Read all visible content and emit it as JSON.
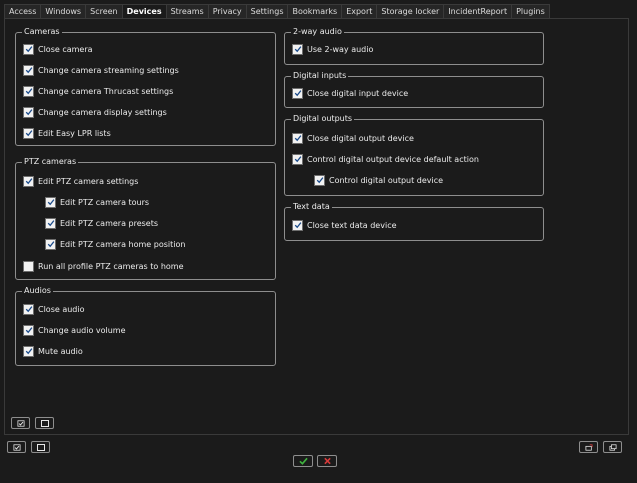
{
  "tabs": [
    "Access",
    "Windows",
    "Screen",
    "Devices",
    "Streams",
    "Privacy",
    "Settings",
    "Bookmarks",
    "Export",
    "Storage locker",
    "IncidentReport",
    "Plugins"
  ],
  "active_tab": "Devices",
  "cameras": {
    "title": "Cameras",
    "items": [
      {
        "label": "Close camera",
        "checked": true
      },
      {
        "label": "Change camera streaming settings",
        "checked": true
      },
      {
        "label": "Change camera Thrucast settings",
        "checked": true
      },
      {
        "label": "Change camera display settings",
        "checked": true
      },
      {
        "label": "Edit Easy LPR lists",
        "checked": true
      }
    ]
  },
  "ptz": {
    "title": "PTZ cameras",
    "items": [
      {
        "label": "Edit PTZ camera settings",
        "checked": true
      },
      {
        "label": "Edit PTZ camera tours",
        "checked": true
      },
      {
        "label": "Edit PTZ camera presets",
        "checked": true
      },
      {
        "label": "Edit PTZ camera home position",
        "checked": true
      },
      {
        "label": "Run all profile PTZ cameras to home",
        "checked": false
      }
    ]
  },
  "audios": {
    "title": "Audios",
    "items": [
      {
        "label": "Close audio",
        "checked": true
      },
      {
        "label": "Change audio volume",
        "checked": true
      },
      {
        "label": "Mute audio",
        "checked": true
      }
    ]
  },
  "two_way": {
    "title": "2-way audio",
    "items": [
      {
        "label": "Use 2-way audio",
        "checked": true
      }
    ]
  },
  "digital_inputs": {
    "title": "Digital inputs",
    "items": [
      {
        "label": "Close digital input device",
        "checked": true
      }
    ]
  },
  "digital_outputs": {
    "title": "Digital outputs",
    "items": [
      {
        "label": "Close digital output device",
        "checked": true
      },
      {
        "label": "Control digital output device default action",
        "checked": true
      },
      {
        "label": "Control digital output device",
        "checked": true
      }
    ]
  },
  "text_data": {
    "title": "Text data",
    "items": [
      {
        "label": "Close text data device",
        "checked": true
      }
    ]
  },
  "colors": {
    "ok": "#3fb43f",
    "cancel": "#d83a3a",
    "background": "#1b1b1b",
    "border": "#8e8e8e"
  }
}
